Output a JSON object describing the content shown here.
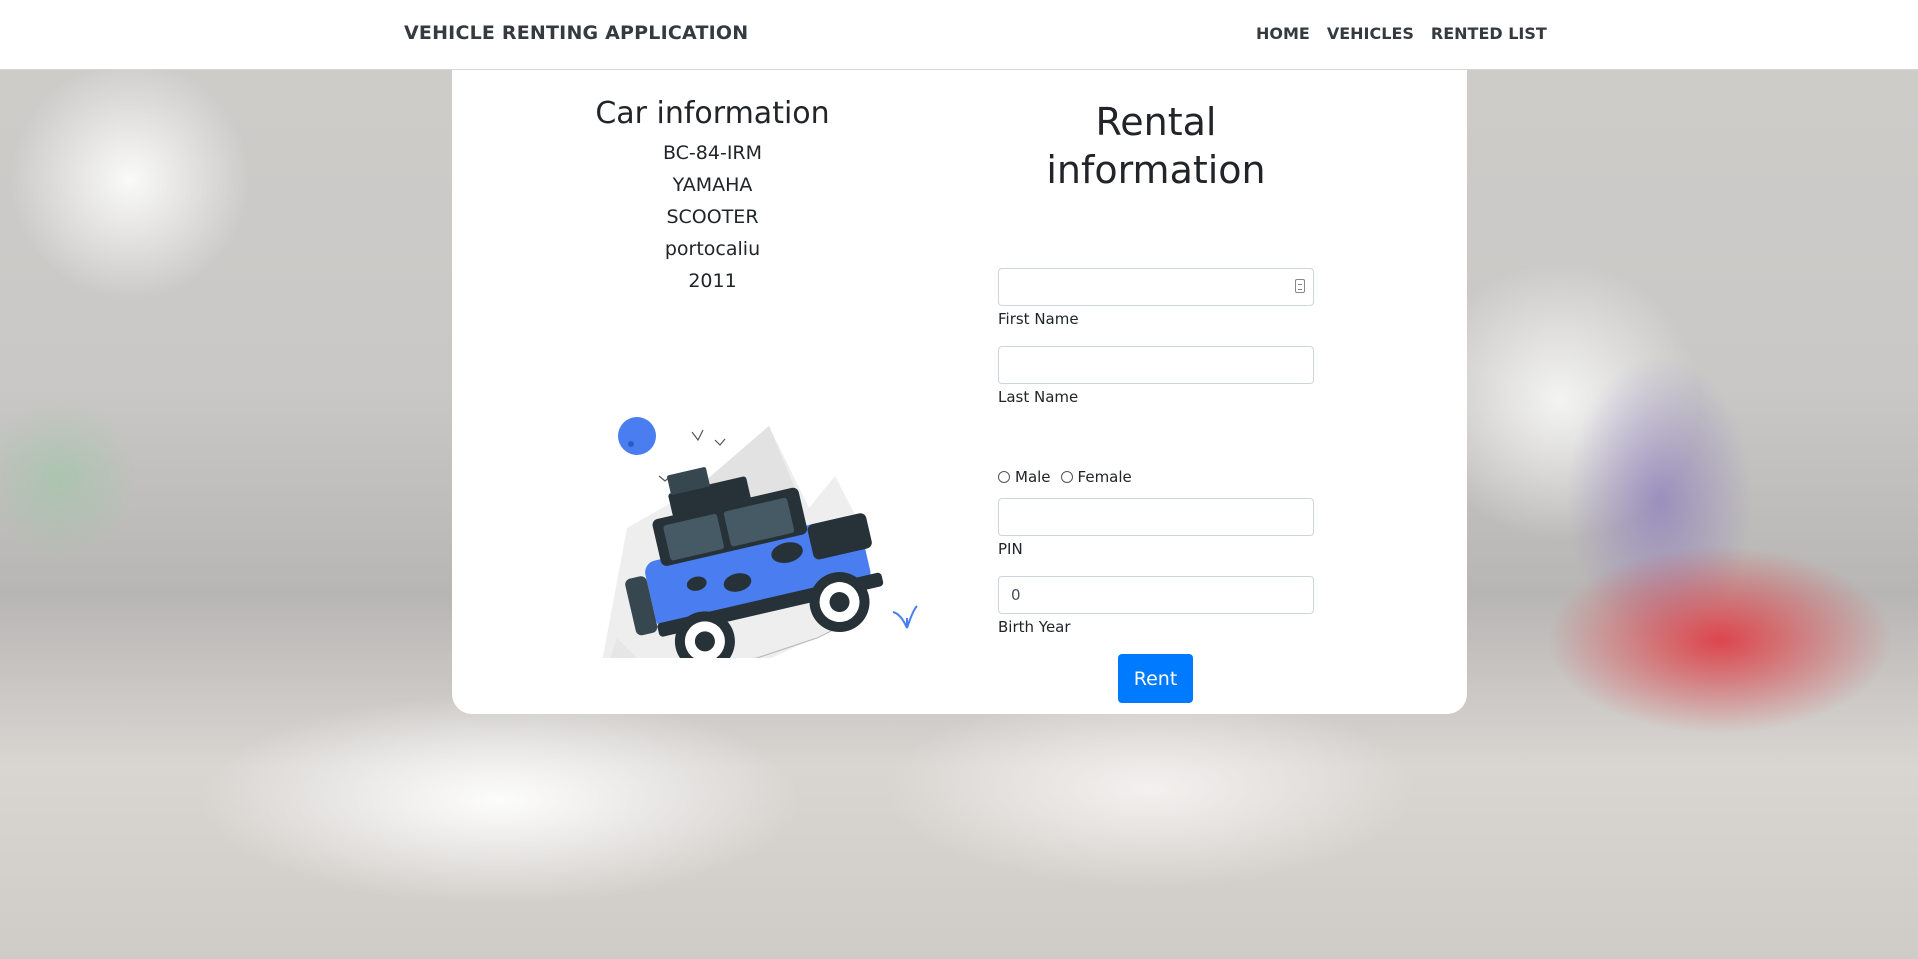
{
  "navbar": {
    "brand": "VEHICLE RENTING APPLICATION",
    "links": [
      "HOME",
      "VEHICLES",
      "RENTED LIST"
    ]
  },
  "car": {
    "title": "Car information",
    "plate": "BC-84-IRM",
    "make": "YAMAHA",
    "type": "SCOOTER",
    "color": "portocaliu",
    "year": "2011"
  },
  "rental": {
    "title_line1": "Rental",
    "title_line2": "information",
    "first_name": {
      "label": "First Name",
      "value": ""
    },
    "last_name": {
      "label": "Last Name",
      "value": ""
    },
    "gender_options": [
      "Male",
      "Female"
    ],
    "pin": {
      "label": "PIN",
      "value": ""
    },
    "birth_year": {
      "label": "Birth Year",
      "value": "0"
    },
    "submit_label": "Rent"
  },
  "colors": {
    "accent": "#007bff",
    "illustration_blue": "#4a7ef0"
  }
}
